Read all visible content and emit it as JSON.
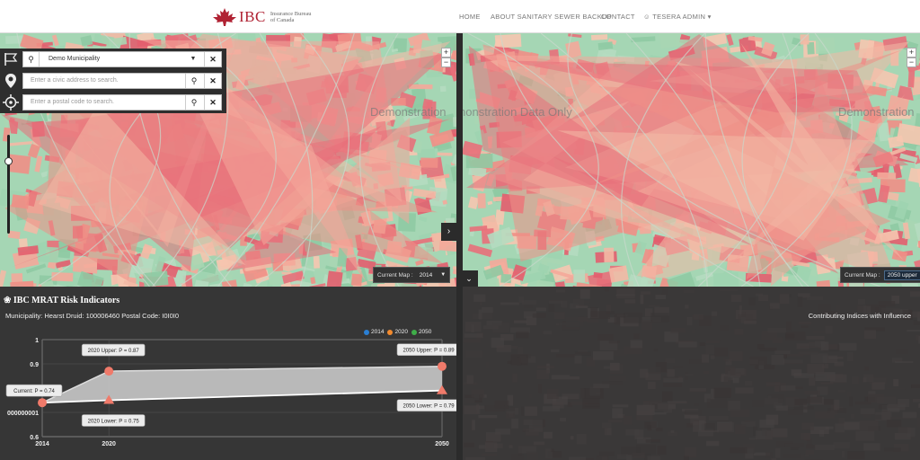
{
  "header": {
    "logo_text": "IBC",
    "logo_sub": "Insurance Bureau of Canada",
    "nav": [
      {
        "label": "HOME"
      },
      {
        "label": "ABOUT SANITARY SEWER BACKUP"
      },
      {
        "label": "CONTACT"
      },
      {
        "label": "TESERA ADMIN"
      }
    ]
  },
  "search": {
    "municipality": "Demo Municipality",
    "address_placeholder": "Enter a civic address to search.",
    "postal_placeholder": "Enter a postal code to search."
  },
  "maps": {
    "watermark": "Demonstration Data Only",
    "left_watermark_1": "Demonstration",
    "right_watermark_1": "nonstration Data Only",
    "right_watermark_2": "Demonstration",
    "left_current_label": "Current Map :",
    "left_current_value": "2014",
    "right_current_label": "Current Map :",
    "right_current_value": "2050 upper",
    "zoom_in": "+",
    "zoom_out": "−"
  },
  "panel": {
    "title": "IBC MRAT Risk Indicators",
    "subtitle": "Municipality: Hearst Druid: 100006460 Postal Code: I0I0I0",
    "contrib": "Contributing Indices with Influence"
  },
  "colors": {
    "y2014": "#2a7fd4",
    "y2020": "#f28a2e",
    "y2050": "#3fae49",
    "marker": "#f07a6a",
    "band": "#c8c8c8"
  },
  "chart_data": {
    "type": "line",
    "x": [
      2014,
      2020,
      2050
    ],
    "y_ticks": [
      "1",
      "0.9",
      "000000001",
      "0.6"
    ],
    "x_ticks": [
      "2014",
      "2020",
      "2050"
    ],
    "ylim": [
      0.6,
      1.0
    ],
    "legend": [
      "2014",
      "2020",
      "2050"
    ],
    "series": [
      {
        "name": "Upper",
        "values": [
          0.74,
          0.87,
          0.89
        ]
      },
      {
        "name": "Lower",
        "values": [
          0.74,
          0.75,
          0.79
        ]
      }
    ],
    "annotations": [
      {
        "label": "Current: P = 0.74"
      },
      {
        "label": "2020 Upper: P = 0.87"
      },
      {
        "label": "2020 Lower: P = 0.75"
      },
      {
        "label": "2050 Upper: P = 0.89"
      },
      {
        "label": "2050 Lower: P = 0.79"
      }
    ]
  }
}
